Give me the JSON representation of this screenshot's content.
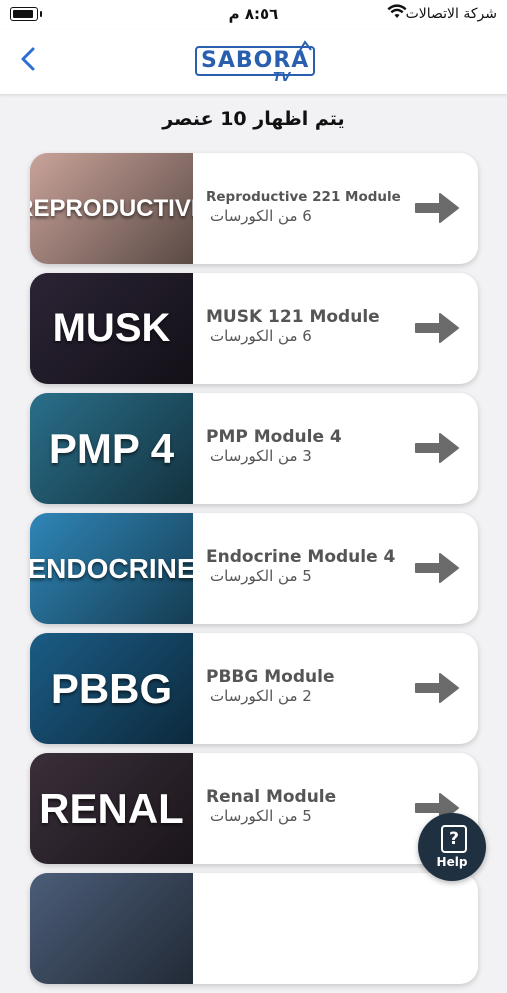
{
  "status_bar": {
    "time": "٨:٥٦ م",
    "carrier": "شركة الاتصالات"
  },
  "nav": {
    "logo_text": "SABORA",
    "logo_sub": "TV"
  },
  "list_header": "يتم اظهار 10 عنصر",
  "modules": [
    {
      "thumb": "REPRODUCTIVE",
      "title": "Reproductive 221 Module",
      "courses": "6 من الكورسات",
      "bg": "#c9a39a",
      "title_small": true,
      "thumb_size": 24
    },
    {
      "thumb": "MUSK",
      "title": "MUSK 121 Module",
      "courses": "6 من الكورسات",
      "bg": "#2b2435",
      "title_small": false,
      "thumb_size": 40
    },
    {
      "thumb": "PMP 4",
      "title": "PMP Module 4",
      "courses": "3 من الكورسات",
      "bg": "#2a6f8a",
      "title_small": false,
      "thumb_size": 42
    },
    {
      "thumb": "ENDOCRINE",
      "title": "Endocrine Module 4",
      "courses": "5 من الكورسات",
      "bg": "#2f86b7",
      "title_small": false,
      "thumb_size": 28
    },
    {
      "thumb": "PBBG",
      "title": "PBBG Module",
      "courses": "2 من الكورسات",
      "bg": "#1b5c86",
      "title_small": false,
      "thumb_size": 42
    },
    {
      "thumb": "RENAL",
      "title": "Renal Module",
      "courses": "5 من الكورسات",
      "bg": "#3a2f3a",
      "title_small": false,
      "thumb_size": 42
    },
    {
      "thumb": "",
      "title": "",
      "courses": "",
      "bg": "#4b5d78",
      "title_small": false,
      "thumb_size": 28
    }
  ],
  "help": {
    "label": "Help",
    "glyph": "?"
  },
  "colors": {
    "accent": "#2a5fb0",
    "arrow": "#6b6b6b",
    "help_bg": "#1f3040"
  }
}
